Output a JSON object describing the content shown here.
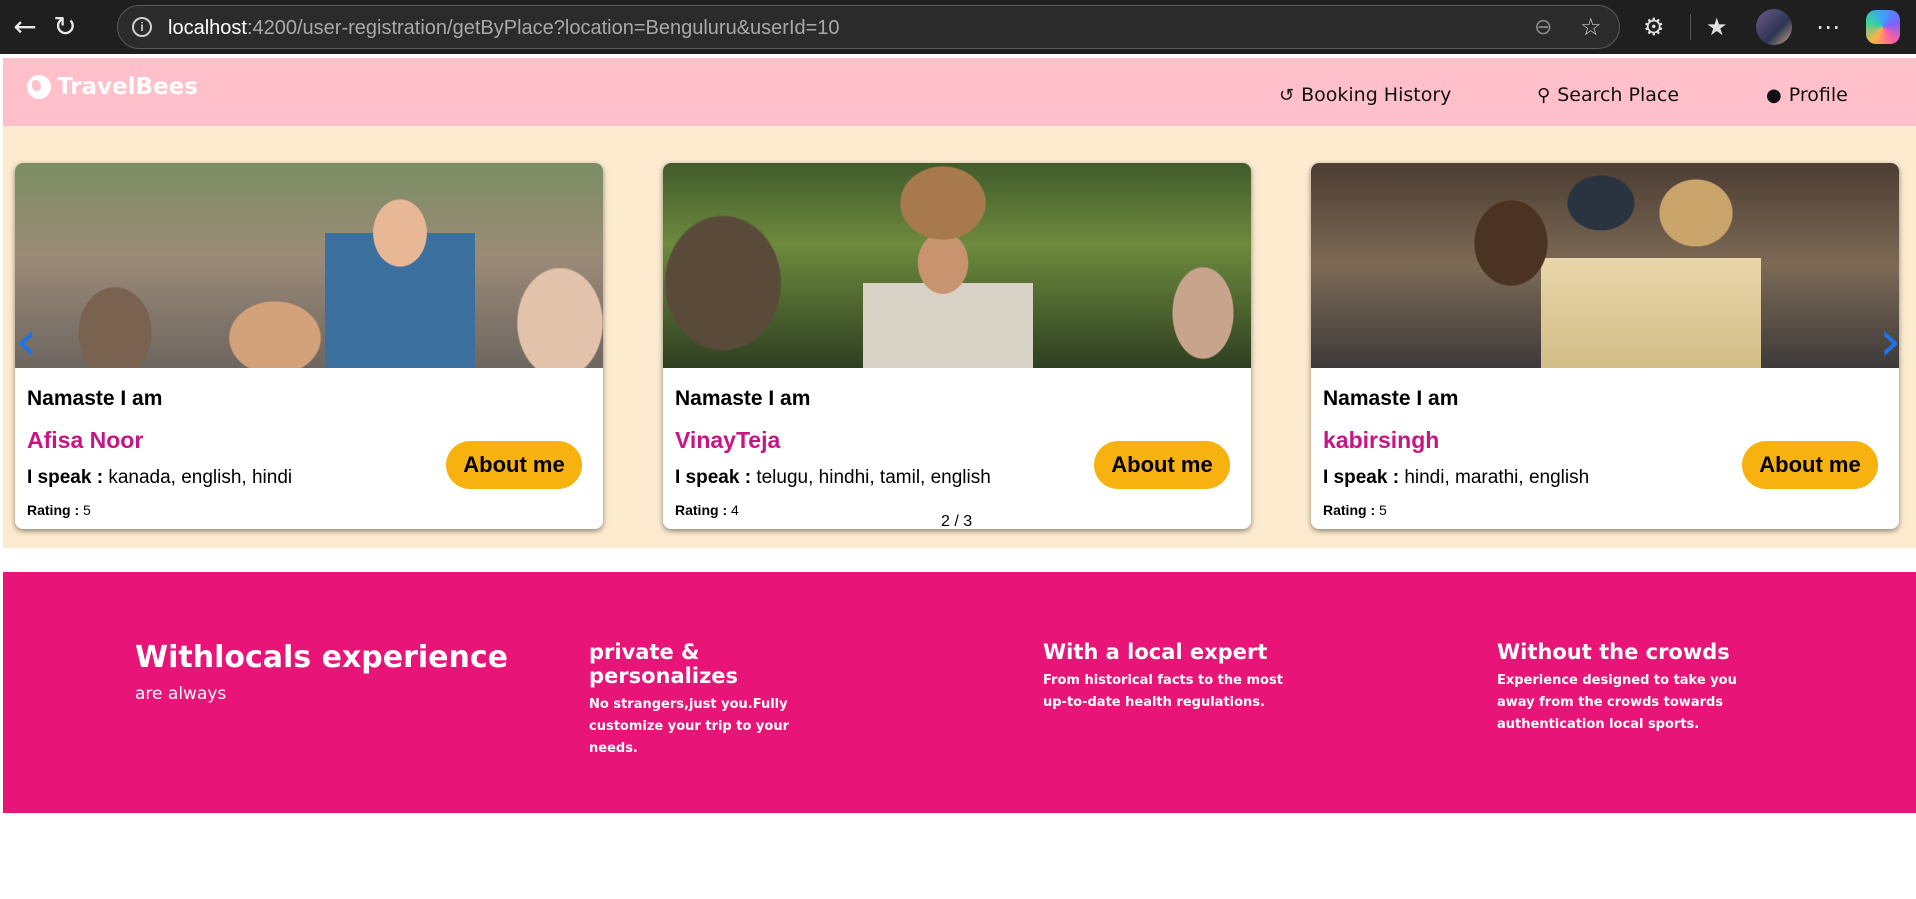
{
  "browser": {
    "url_host": "localhost",
    "url_rest": ":4200/user-registration/getByPlace?location=Benguluru&userId=10"
  },
  "navbar": {
    "brand": "TravelBees",
    "items": [
      {
        "label": "Booking History",
        "icon": "history-icon"
      },
      {
        "label": "Search Place",
        "icon": "search-icon"
      },
      {
        "label": "Profile",
        "icon": "user-circle-icon"
      }
    ]
  },
  "carousel": {
    "counter": "2 / 3",
    "cards": [
      {
        "intro": "Namaste I am",
        "name": "Afisa Noor",
        "speak_label": "I speak :",
        "languages": "kanada, english, hindi",
        "rating_label": "Rating :",
        "rating": "5",
        "button": "About me"
      },
      {
        "intro": "Namaste I am",
        "name": "VinayTeja",
        "speak_label": "I speak :",
        "languages": "telugu, hindhi, tamil, english",
        "rating_label": "Rating :",
        "rating": "4",
        "button": "About me"
      },
      {
        "intro": "Namaste I am",
        "name": "kabirsingh",
        "speak_label": "I speak :",
        "languages": "hindi, marathi, english",
        "rating_label": "Rating :",
        "rating": "5",
        "button": "About me"
      }
    ]
  },
  "features": {
    "title": "Withlocals experience",
    "subtitle": "are always",
    "columns": [
      {
        "heading": "private & personalizes",
        "text": "No strangers,just you.Fully customize your trip to your needs."
      },
      {
        "heading": "With a local expert",
        "text": "From historical facts to the most up-to-date health regulations."
      },
      {
        "heading": "Without the crowds",
        "text": "Experience designed to take you away from the crowds towards authentication local sports."
      }
    ]
  },
  "colors": {
    "navbar_bg": "#ffc0cb",
    "carousel_bg": "#fdebd0",
    "name_color": "#c71585",
    "button_bg": "#f7b20f",
    "footer_bg": "#e91477",
    "arrow_color": "#1e73e8"
  }
}
